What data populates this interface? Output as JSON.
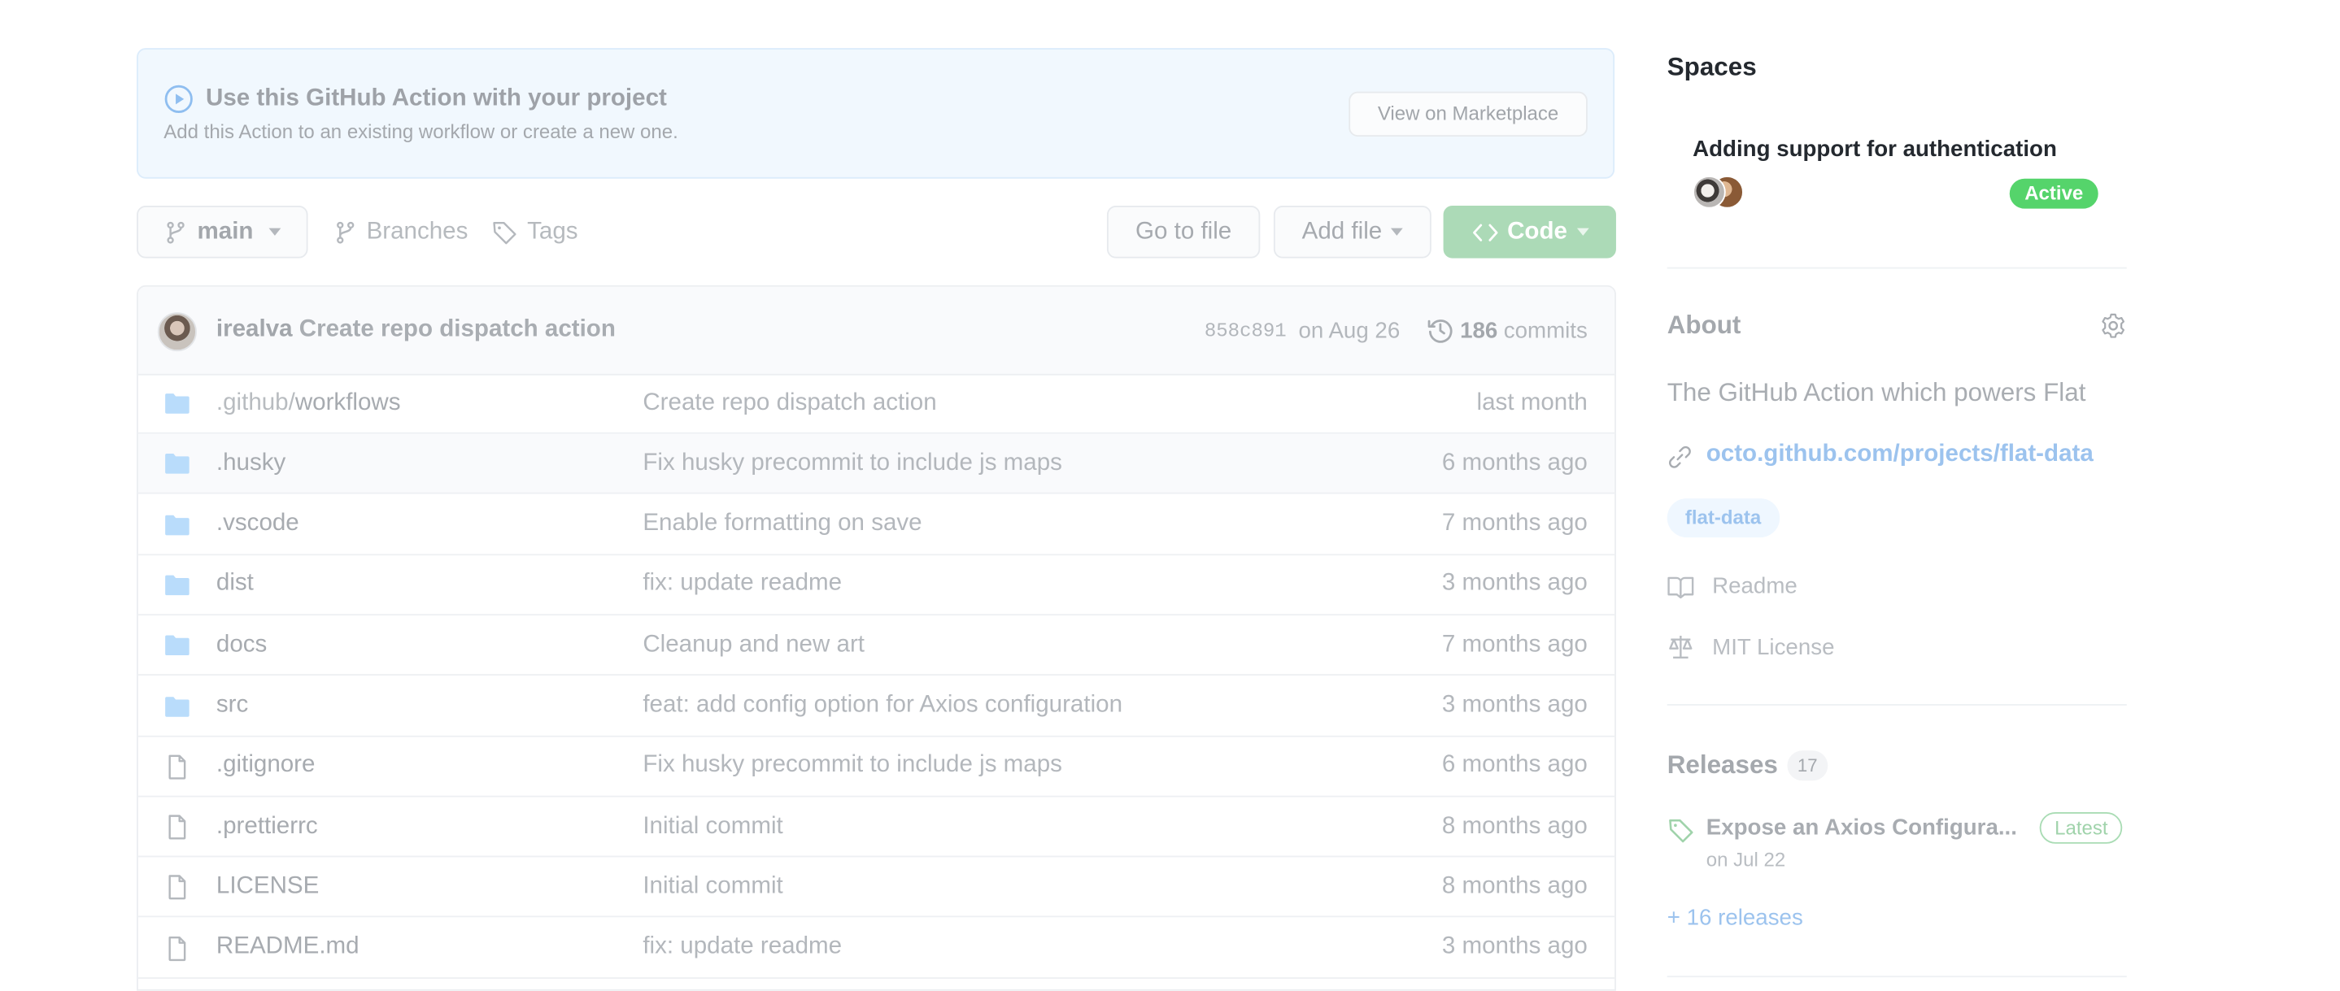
{
  "banner": {
    "title": "Use this GitHub Action with your project",
    "subtitle": "Add this Action to an existing workflow or create a new one.",
    "marketplace_button": "View on Marketplace",
    "icon": "play-circle-icon"
  },
  "toolbar": {
    "branch": "main",
    "branches_label": "Branches",
    "tags_label": "Tags",
    "goto_file": "Go to file",
    "add_file": "Add file",
    "code": "Code"
  },
  "latest_commit": {
    "author": "irealva",
    "message": "Create repo dispatch action",
    "sha": "858c891",
    "date": "on Aug 26",
    "commit_count": "186",
    "commits_label": "commits"
  },
  "files": [
    {
      "type": "folder",
      "prefix": ".github/",
      "name": "workflows",
      "message": "Create repo dispatch action",
      "age": "last month"
    },
    {
      "type": "folder",
      "prefix": "",
      "name": ".husky",
      "message": "Fix husky precommit to include js maps",
      "age": "6 months ago"
    },
    {
      "type": "folder",
      "prefix": "",
      "name": ".vscode",
      "message": "Enable formatting on save",
      "age": "7 months ago"
    },
    {
      "type": "folder",
      "prefix": "",
      "name": "dist",
      "message": "fix: update readme",
      "age": "3 months ago"
    },
    {
      "type": "folder",
      "prefix": "",
      "name": "docs",
      "message": "Cleanup and new art",
      "age": "7 months ago"
    },
    {
      "type": "folder",
      "prefix": "",
      "name": "src",
      "message": "feat: add config option for Axios configuration",
      "age": "3 months ago"
    },
    {
      "type": "file",
      "prefix": "",
      "name": ".gitignore",
      "message": "Fix husky precommit to include js maps",
      "age": "6 months ago"
    },
    {
      "type": "file",
      "prefix": "",
      "name": ".prettierrc",
      "message": "Initial commit",
      "age": "8 months ago"
    },
    {
      "type": "file",
      "prefix": "",
      "name": "LICENSE",
      "message": "Initial commit",
      "age": "8 months ago"
    },
    {
      "type": "file",
      "prefix": "",
      "name": "README.md",
      "message": "fix: update readme",
      "age": "3 months ago"
    }
  ],
  "sidebar": {
    "spaces": {
      "title": "Spaces",
      "item": {
        "name": "Adding support for authentication",
        "status": "Active"
      }
    },
    "about": {
      "title": "About",
      "description": "The GitHub Action which powers Flat",
      "link": "octo.github.com/projects/flat-data",
      "topics": [
        "flat-data"
      ],
      "readme": "Readme",
      "license": "MIT License"
    },
    "releases": {
      "title": "Releases",
      "count": "17",
      "latest_name": "Expose an Axios Configura...",
      "latest_badge": "Latest",
      "latest_date": "on Jul 22",
      "more": "+ 16 releases"
    }
  },
  "colors": {
    "accent_green": "#55d46b",
    "code_button": "#acdab7",
    "link_blue": "#9cc3ee",
    "folder_blue": "#b9dcfb"
  }
}
